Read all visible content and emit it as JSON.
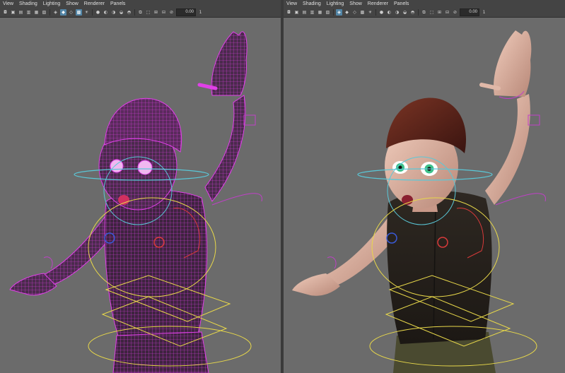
{
  "left_panel": {
    "menu": [
      "View",
      "Shading",
      "Lighting",
      "Show",
      "Renderer",
      "Panels"
    ],
    "field_value": "0.00",
    "trailing": "1",
    "display_mode": "wireframe"
  },
  "right_panel": {
    "menu": [
      "View",
      "Shading",
      "Lighting",
      "Show",
      "Renderer",
      "Panels"
    ],
    "field_value": "0.00",
    "trailing": "1",
    "display_mode": "shaded"
  },
  "colors": {
    "viewport_bg": "#6b6b6b",
    "wireframe": "#e040e8",
    "ctrl_cyan": "#5ac8d8",
    "ctrl_yellow": "#e8d84a",
    "ctrl_red": "#d83a3a",
    "ctrl_blue": "#3a5ad8",
    "ctrl_magenta": "#c040c8",
    "skin": "#e0b8a8",
    "hair": "#5a2418",
    "shirt": "#2a241e",
    "pants": "#4a4a30",
    "eye": "#3ec08a"
  }
}
